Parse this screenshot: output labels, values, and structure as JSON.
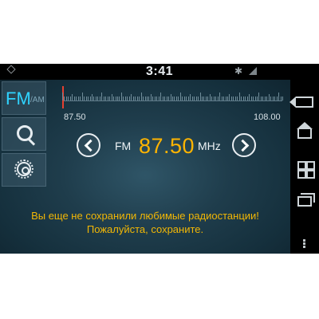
{
  "status_bar": {
    "time": "3:41",
    "bluetooth_icon": "bluetooth-icon",
    "signal_icon": "signal-icon"
  },
  "band_selector": {
    "active_band": "FM",
    "inactive_band": "/AM"
  },
  "tuner": {
    "min_freq": "87.50",
    "max_freq": "108.00",
    "current_position_fraction": 0.0
  },
  "frequency": {
    "band": "FM",
    "value": "87.50",
    "unit": "MHz"
  },
  "message": {
    "line1": "Вы еще не сохранили любимые радиостанции!",
    "line2": "Пожалуйста, сохраните."
  },
  "colors": {
    "accent_blue": "#2fd3ff",
    "frequency_yellow": "#ffb400",
    "message_yellow": "#f2b705",
    "needle_red": "#e64030"
  },
  "left_panel_icons": [
    "search-icon",
    "settings-gear-icon"
  ],
  "nav_icons": [
    "back-icon",
    "home-icon",
    "apps-grid-icon",
    "recent-apps-icon",
    "menu-dots-icon"
  ]
}
